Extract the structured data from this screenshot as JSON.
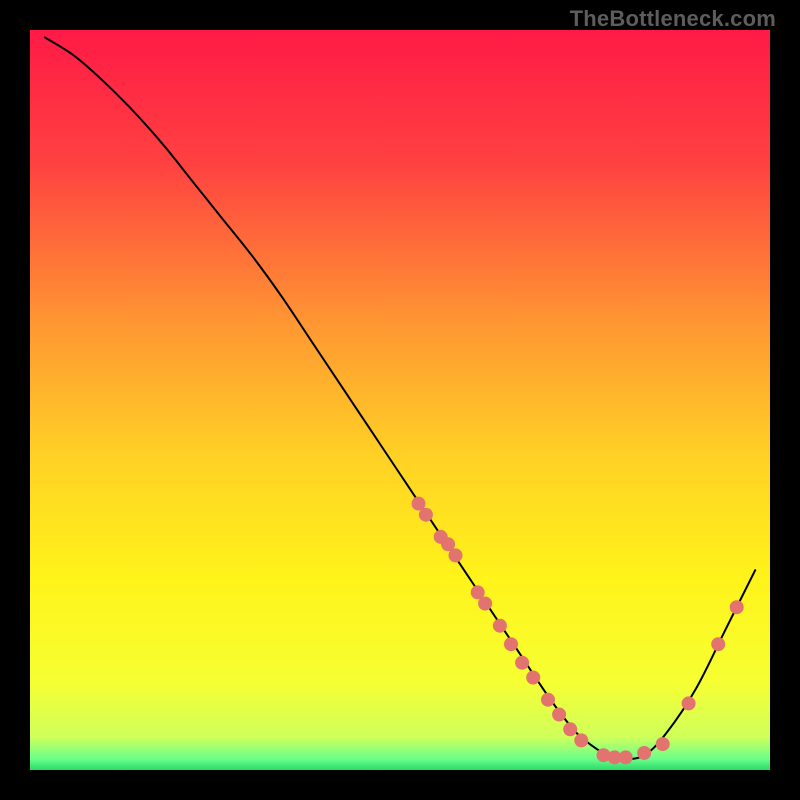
{
  "watermark": "TheBottleneck.com",
  "chart_data": {
    "type": "line",
    "title": "",
    "xlabel": "",
    "ylabel": "",
    "xlim": [
      0,
      100
    ],
    "ylim": [
      0,
      100
    ],
    "grid": false,
    "legend": false,
    "background": {
      "type": "vertical-gradient",
      "stops": [
        {
          "offset": 0.0,
          "color": "#ff1a46"
        },
        {
          "offset": 0.18,
          "color": "#ff4141"
        },
        {
          "offset": 0.4,
          "color": "#ff9832"
        },
        {
          "offset": 0.58,
          "color": "#ffd225"
        },
        {
          "offset": 0.74,
          "color": "#fff31a"
        },
        {
          "offset": 0.88,
          "color": "#f6ff32"
        },
        {
          "offset": 0.955,
          "color": "#d0ff5a"
        },
        {
          "offset": 0.985,
          "color": "#6bff8a"
        },
        {
          "offset": 1.0,
          "color": "#2bd96a"
        }
      ]
    },
    "series": [
      {
        "name": "bottleneck-curve",
        "color": "#000000",
        "stroke_width": 2,
        "x": [
          2,
          6,
          10,
          14,
          18,
          22,
          26,
          30,
          34,
          38,
          42,
          46,
          50,
          52,
          56,
          60,
          64,
          66,
          70,
          73,
          75,
          78,
          80,
          83,
          86,
          90,
          94,
          98
        ],
        "y": [
          99,
          96.5,
          93,
          89,
          84.5,
          79.5,
          74.5,
          69.5,
          64,
          58,
          52,
          46,
          40,
          37,
          31,
          25,
          19,
          16,
          10,
          6,
          4,
          2,
          1.5,
          2,
          5,
          11,
          19,
          27
        ]
      }
    ],
    "scatter": [
      {
        "name": "curve-markers",
        "color": "#e2736e",
        "radius": 7,
        "points": [
          {
            "x": 52.5,
            "y": 36
          },
          {
            "x": 53.5,
            "y": 34.5
          },
          {
            "x": 55.5,
            "y": 31.5
          },
          {
            "x": 56.5,
            "y": 30.5
          },
          {
            "x": 57.5,
            "y": 29
          },
          {
            "x": 60.5,
            "y": 24
          },
          {
            "x": 61.5,
            "y": 22.5
          },
          {
            "x": 63.5,
            "y": 19.5
          },
          {
            "x": 65.0,
            "y": 17
          },
          {
            "x": 66.5,
            "y": 14.5
          },
          {
            "x": 68.0,
            "y": 12.5
          },
          {
            "x": 70.0,
            "y": 9.5
          },
          {
            "x": 71.5,
            "y": 7.5
          },
          {
            "x": 73.0,
            "y": 5.5
          },
          {
            "x": 74.5,
            "y": 4
          },
          {
            "x": 77.5,
            "y": 2
          },
          {
            "x": 79.0,
            "y": 1.7
          },
          {
            "x": 80.5,
            "y": 1.7
          },
          {
            "x": 83.0,
            "y": 2.3
          },
          {
            "x": 85.5,
            "y": 3.5
          },
          {
            "x": 89.0,
            "y": 9
          },
          {
            "x": 93.0,
            "y": 17
          },
          {
            "x": 95.5,
            "y": 22
          }
        ]
      }
    ],
    "annotations": []
  }
}
